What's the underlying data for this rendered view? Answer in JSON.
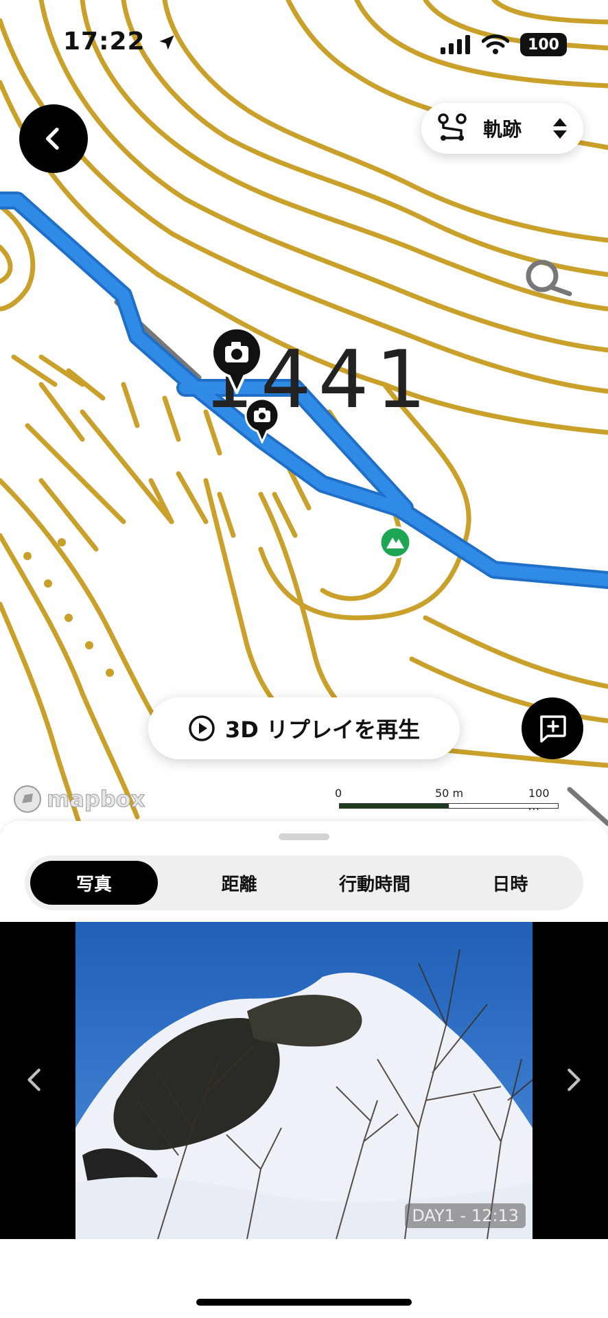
{
  "status_bar": {
    "time": "17:22",
    "battery": "100"
  },
  "header": {
    "track_selector_label": "軌跡"
  },
  "map": {
    "elevation_label": "1441",
    "replay_button_label": "3D リプレイを再生",
    "attribution": "mapbox",
    "scale": {
      "start": "0",
      "mid": "50 m",
      "end": "100 m"
    },
    "colors": {
      "contour": "#c9a02a",
      "track": "#2f8be6",
      "summit_marker": "#1fa654"
    }
  },
  "sheet": {
    "tabs": [
      {
        "label": "写真",
        "active": true
      },
      {
        "label": "距離",
        "active": false
      },
      {
        "label": "行動時間",
        "active": false
      },
      {
        "label": "日時",
        "active": false
      }
    ],
    "photo_caption": "DAY1 - 12:13"
  },
  "icons": {
    "back": "chevron-left-icon",
    "route": "route-icon",
    "sort": "up-down-arrows-icon",
    "play": "play-circle-icon",
    "add_post": "add-comment-icon",
    "camera": "camera-pin-icon",
    "summit": "mountain-pin-icon"
  }
}
